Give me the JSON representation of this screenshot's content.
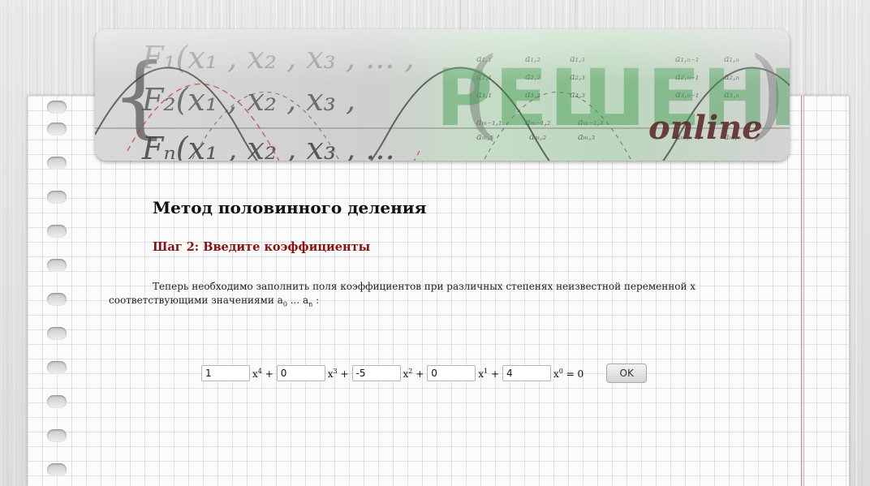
{
  "header": {
    "banner_text": "РЕШЕНИЕ",
    "banner_subtext": "online"
  },
  "main": {
    "title": "Метод половинного деления",
    "step_title": "Шаг 2: Введите коэффициенты",
    "description_text": "Теперь необходимо заполнить поля коэффициентов при различных степенях неизвестной переменной x соответствующими значениями a",
    "description_sub_start": "0",
    "description_ellipsis": " ... a",
    "description_sub_end": "n",
    "description_end": " :"
  },
  "equation": {
    "terms": [
      {
        "value": "1",
        "base": "x",
        "power": "4",
        "sep": " +"
      },
      {
        "value": "0",
        "base": "x",
        "power": "3",
        "sep": " +"
      },
      {
        "value": "-5",
        "base": "x",
        "power": "2",
        "sep": " +"
      },
      {
        "value": "0",
        "base": "x",
        "power": "1",
        "sep": " +"
      },
      {
        "value": "4",
        "base": "x",
        "power": "0",
        "sep": " = 0"
      }
    ],
    "ok_label": "OK"
  },
  "colors": {
    "step_title": "#8b1010",
    "margin_line": "#c58b8b",
    "banner_green": "#bcd7bd"
  }
}
